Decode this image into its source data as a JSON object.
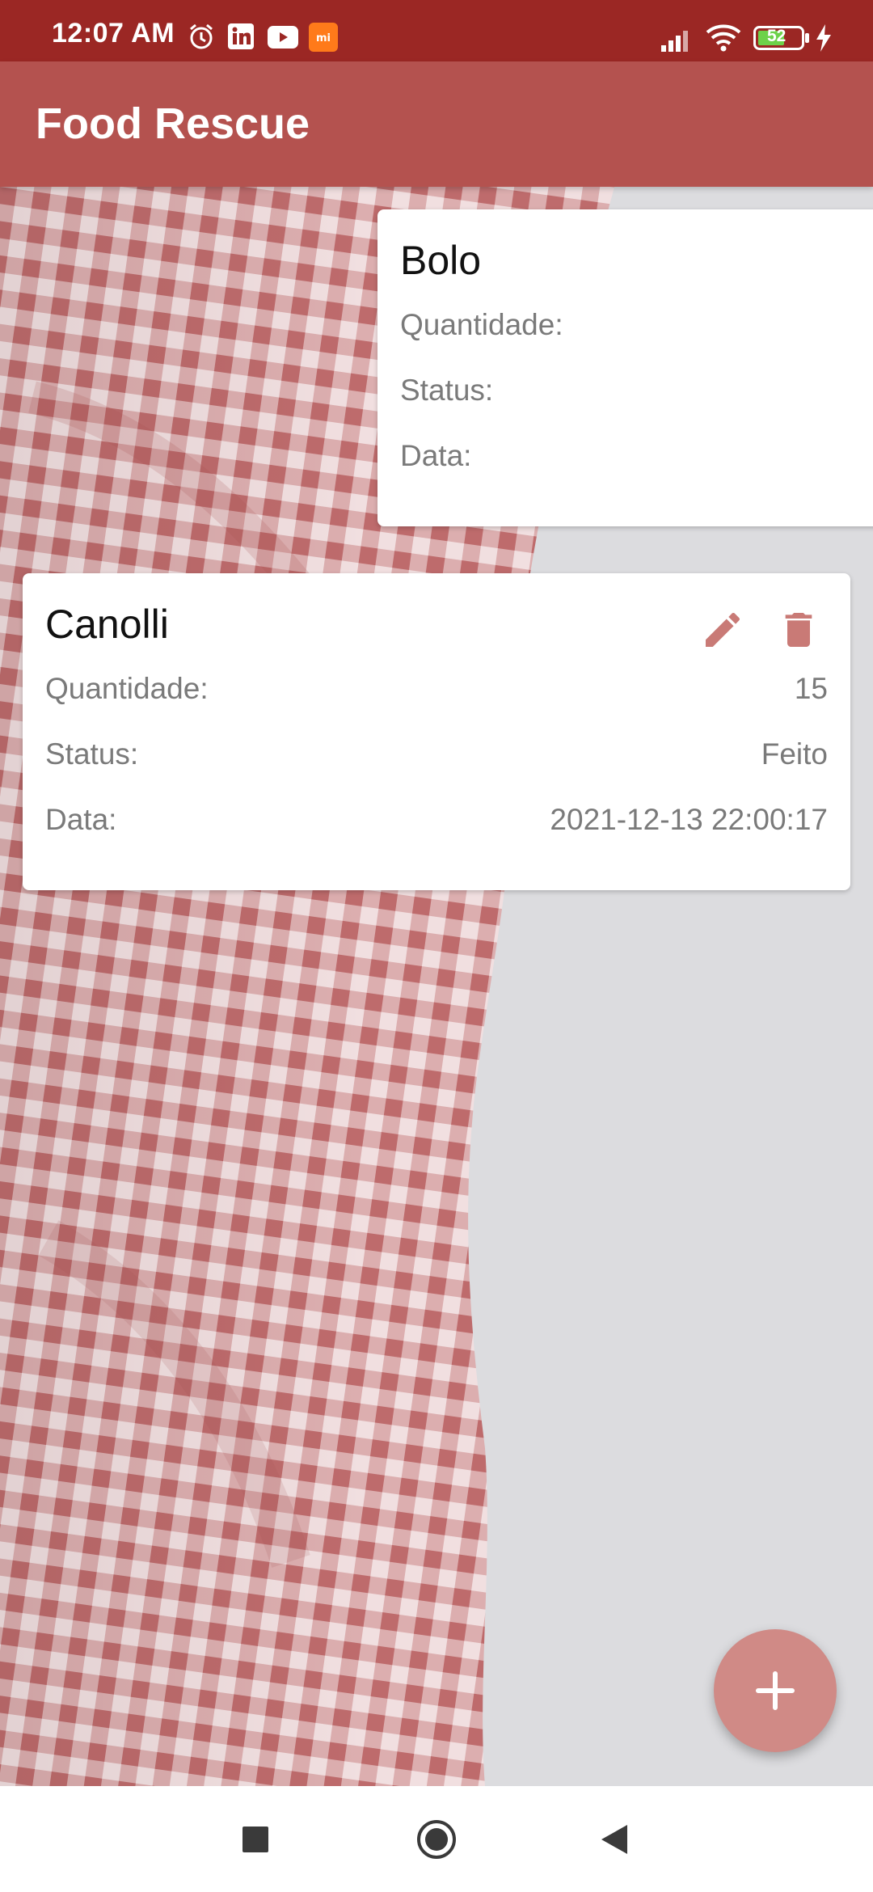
{
  "status_bar": {
    "time": "12:07 AM",
    "battery": "52",
    "icons": [
      "alarm-icon",
      "linkedin-icon",
      "youtube-icon",
      "mi-icon",
      "signal-icon",
      "wifi-icon",
      "battery-icon",
      "charging-icon"
    ]
  },
  "app": {
    "title": "Food Rescue"
  },
  "cards": [
    {
      "name": "Bolo",
      "quantity_label": "Quantidade:",
      "quantity": "",
      "status_label": "Status:",
      "status": "",
      "date_label": "Data:",
      "date": ""
    },
    {
      "name": "Canolli",
      "quantity_label": "Quantidade:",
      "quantity": "15",
      "status_label": "Status:",
      "status": "Feito",
      "date_label": "Data:",
      "date": "2021-12-13 22:00:17"
    }
  ],
  "colors": {
    "status_bar": "#9b2724",
    "toolbar": "#b4524f",
    "accent": "#c97a76",
    "fab": "#d08a86"
  },
  "nav": {
    "icons": [
      "recents-square-icon",
      "home-circle-icon",
      "back-triangle-icon"
    ]
  }
}
